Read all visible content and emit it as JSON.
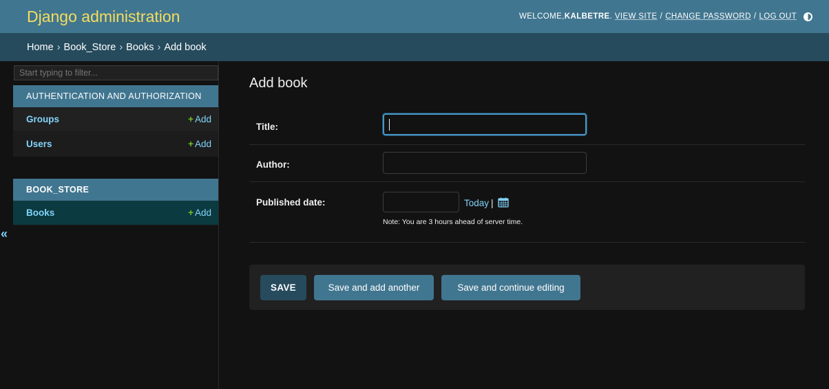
{
  "header": {
    "brand": "Django administration",
    "welcome_prefix": "WELCOME, ",
    "username": "KALBETRE",
    "welcome_suffix": ".",
    "view_site": "VIEW SITE",
    "change_password": "CHANGE PASSWORD",
    "log_out": "LOG OUT",
    "separator": "/"
  },
  "breadcrumbs": [
    "Home",
    "Book_Store",
    "Books",
    "Add book"
  ],
  "breadcrumb_separator": "›",
  "sidebar": {
    "filter_placeholder": "Start typing to filter...",
    "modules": [
      {
        "caption": "AUTHENTICATION AND AUTHORIZATION",
        "models": [
          {
            "name": "Groups",
            "add_label": "Add"
          },
          {
            "name": "Users",
            "add_label": "Add"
          }
        ]
      },
      {
        "caption": "BOOK_STORE",
        "models": [
          {
            "name": "Books",
            "add_label": "Add"
          }
        ]
      }
    ],
    "add_plus": "+",
    "collapse_glyph": "«"
  },
  "content": {
    "title": "Add book",
    "fields": {
      "title_label": "Title:",
      "title_value": "",
      "author_label": "Author:",
      "author_value": "",
      "published_label": "Published date:",
      "published_value": "",
      "today_link": "Today",
      "today_sep": "|",
      "timezone_note": "Note: You are 3 hours ahead of server time."
    },
    "buttons": {
      "save": "SAVE",
      "save_add_another": "Save and add another",
      "save_continue": "Save and continue editing"
    }
  },
  "colors": {
    "header_bg": "#417690",
    "brand": "#f5dd5d",
    "breadcrumbs_bg": "#264b5d",
    "link": "#81d4fa",
    "add_plus": "#70bf2b",
    "selected_row": "#0b3a40",
    "page_bg": "#121212"
  },
  "icons": {
    "theme_toggle": "half-circle-contrast-icon",
    "calendar": "calendar-icon",
    "collapse": "double-chevron-left-icon"
  }
}
